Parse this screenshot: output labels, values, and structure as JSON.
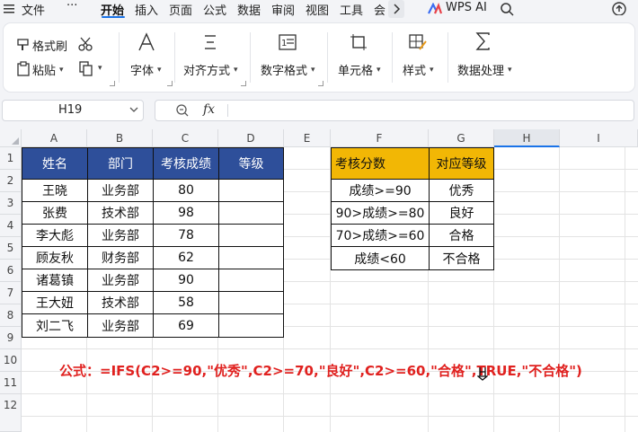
{
  "menubar": {
    "file": "文件",
    "more": "···",
    "tabs": [
      "开始",
      "插入",
      "页面",
      "公式",
      "数据",
      "审阅",
      "视图",
      "工具",
      "会"
    ],
    "wps_ai": "WPS AI"
  },
  "ribbon": {
    "format_painter": "格式刷",
    "paste": "粘贴",
    "font": "字体",
    "align": "对齐方式",
    "number_format": "数字格式",
    "cell": "单元格",
    "style": "样式",
    "data_process": "数据处理"
  },
  "formula_bar": {
    "cell_ref": "H19",
    "fx": "fx",
    "content": ""
  },
  "sheet": {
    "columns": [
      "A",
      "B",
      "C",
      "D",
      "E",
      "F",
      "G",
      "H",
      "I"
    ],
    "rows": [
      "1",
      "2",
      "3",
      "4",
      "5",
      "6",
      "7",
      "8",
      "9",
      "10",
      "11",
      "12"
    ],
    "selected_column": "H",
    "table1": {
      "headers": [
        "姓名",
        "部门",
        "考核成绩",
        "等级"
      ],
      "rows": [
        [
          "王晓",
          "业务部",
          "80",
          ""
        ],
        [
          "张费",
          "技术部",
          "98",
          ""
        ],
        [
          "李大彪",
          "业务部",
          "78",
          ""
        ],
        [
          "顾友秋",
          "财务部",
          "62",
          ""
        ],
        [
          "诸葛镇",
          "业务部",
          "90",
          ""
        ],
        [
          "王大妞",
          "技术部",
          "58",
          ""
        ],
        [
          "刘二飞",
          "业务部",
          "69",
          ""
        ]
      ]
    },
    "table2": {
      "headers": [
        "考核分数",
        "对应等级"
      ],
      "rows": [
        [
          "成绩>=90",
          "优秀"
        ],
        [
          "90>成绩>=80",
          "良好"
        ],
        [
          "70>成绩>=60",
          "合格"
        ],
        [
          "成绩<60",
          "不合格"
        ]
      ]
    },
    "formula_note": "公式：=IFS(C2>=90,\"优秀\",C2>=70,\"良好\",C2>=60,\"合格\",TRUE,\"不合格\")"
  },
  "colors": {
    "header_blue": "#2e4f9a",
    "header_gold": "#f2b705",
    "formula_red": "#e0211f",
    "accent": "#1a73e8"
  }
}
